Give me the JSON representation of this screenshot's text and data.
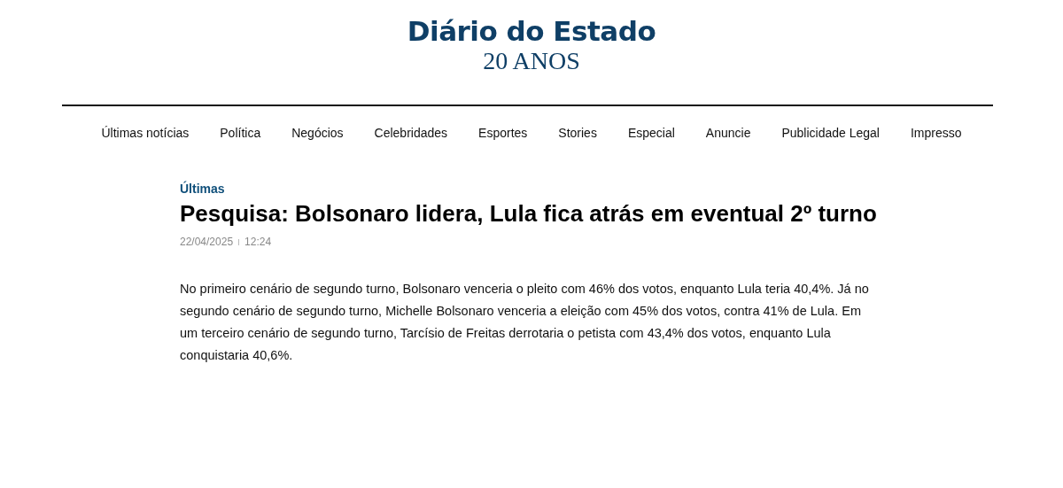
{
  "logo": {
    "title": "Diário do Estado",
    "subtitle": "20 ANOS"
  },
  "nav": [
    "Últimas notícias",
    "Política",
    "Negócios",
    "Celebridades",
    "Esportes",
    "Stories",
    "Especial",
    "Anuncie",
    "Publicidade Legal",
    "Impresso"
  ],
  "article": {
    "category": "Últimas",
    "headline": "Pesquisa: Bolsonaro lidera, Lula fica atrás em eventual 2º turno",
    "date": "22/04/2025",
    "time": "12:24",
    "body": "No primeiro cenário de segundo turno, Bolsonaro venceria o pleito com 46% dos votos, enquanto Lula teria 40,4%. Já no segundo cenário de segundo turno, Michelle Bolsonaro venceria a eleição com 45% dos votos, contra 41% de Lula. Em um terceiro cenário de segundo turno, Tarcísio de Freitas derrotaria o petista com 43,4% dos votos, enquanto Lula conquistaria 40,6%."
  }
}
